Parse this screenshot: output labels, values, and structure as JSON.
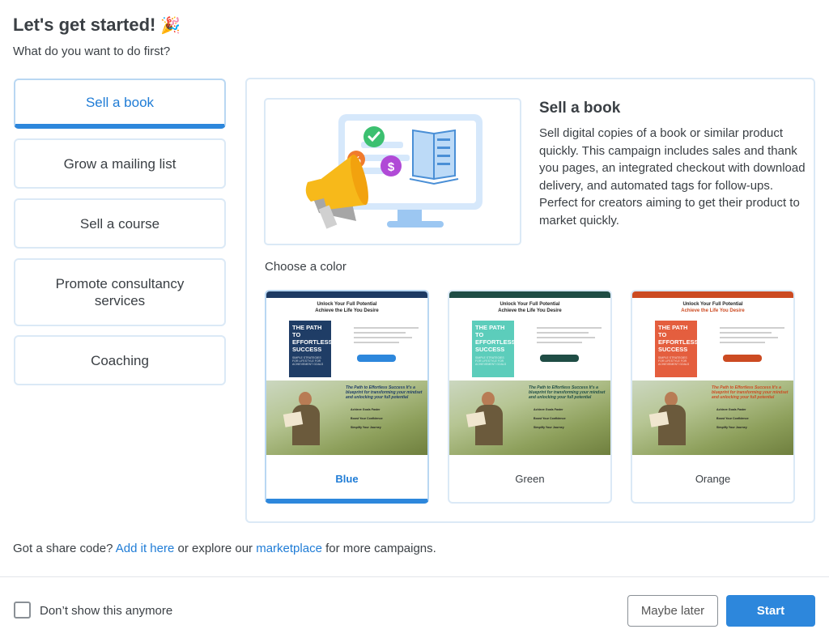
{
  "header": {
    "title": "Let's get started!",
    "title_emoji": "🎉",
    "subtitle": "What do you want to do first?"
  },
  "options": [
    {
      "label": "Sell a book",
      "selected": true
    },
    {
      "label": "Grow a mailing list",
      "selected": false
    },
    {
      "label": "Sell a course",
      "selected": false
    },
    {
      "label": "Promote consultancy services",
      "selected": false
    },
    {
      "label": "Coaching",
      "selected": false
    }
  ],
  "detail": {
    "title": "Sell a book",
    "description": "Sell digital copies of a book or similar product quickly. This campaign includes sales and thank you pages, an integrated checkout with download delivery, and automated tags for follow-ups. Perfect for creators aiming to get their product to market quickly.",
    "illustration_icons": [
      "megaphone-icon",
      "monitor-icon",
      "book-icon",
      "check-icon",
      "percent-icon",
      "dollar-icon"
    ]
  },
  "color_picker": {
    "label": "Choose a color",
    "themes": [
      {
        "name": "Blue",
        "accent": "#1d3a63",
        "book_color": "#1f3d66",
        "selected": true
      },
      {
        "name": "Green",
        "accent": "#1f4d45",
        "book_color": "#5ccdbb",
        "selected": false
      },
      {
        "name": "Orange",
        "accent": "#cc4b22",
        "book_color": "#e45e3e",
        "selected": false
      }
    ],
    "preview": {
      "headline_1": "Unlock Your Full Potential",
      "headline_2": "Achieve the Life You Desire",
      "book_title": "THE PATH TO EFFORTLESS SUCCESS",
      "book_subtitle": "SIMPLE STRATEGIES FOR LIFESTYLE FOR ACHIEVEMENT GOALS",
      "photo_caption": "The Path to Effortless Success It's a blueprint for transforming your mindset and unlocking your full potential",
      "photo_items": [
        "Achieve Goals Faster",
        "Boost Your Confidence",
        "Simplify Your Journey"
      ]
    }
  },
  "footer": {
    "prefix": "Got a share code?",
    "add_link": "Add it here",
    "middle": "or explore our",
    "marketplace_link": "marketplace",
    "suffix": "for more campaigns.",
    "dont_show_label": "Don’t show this anymore",
    "dont_show_checked": false,
    "maybe_later_label": "Maybe later",
    "start_label": "Start"
  }
}
